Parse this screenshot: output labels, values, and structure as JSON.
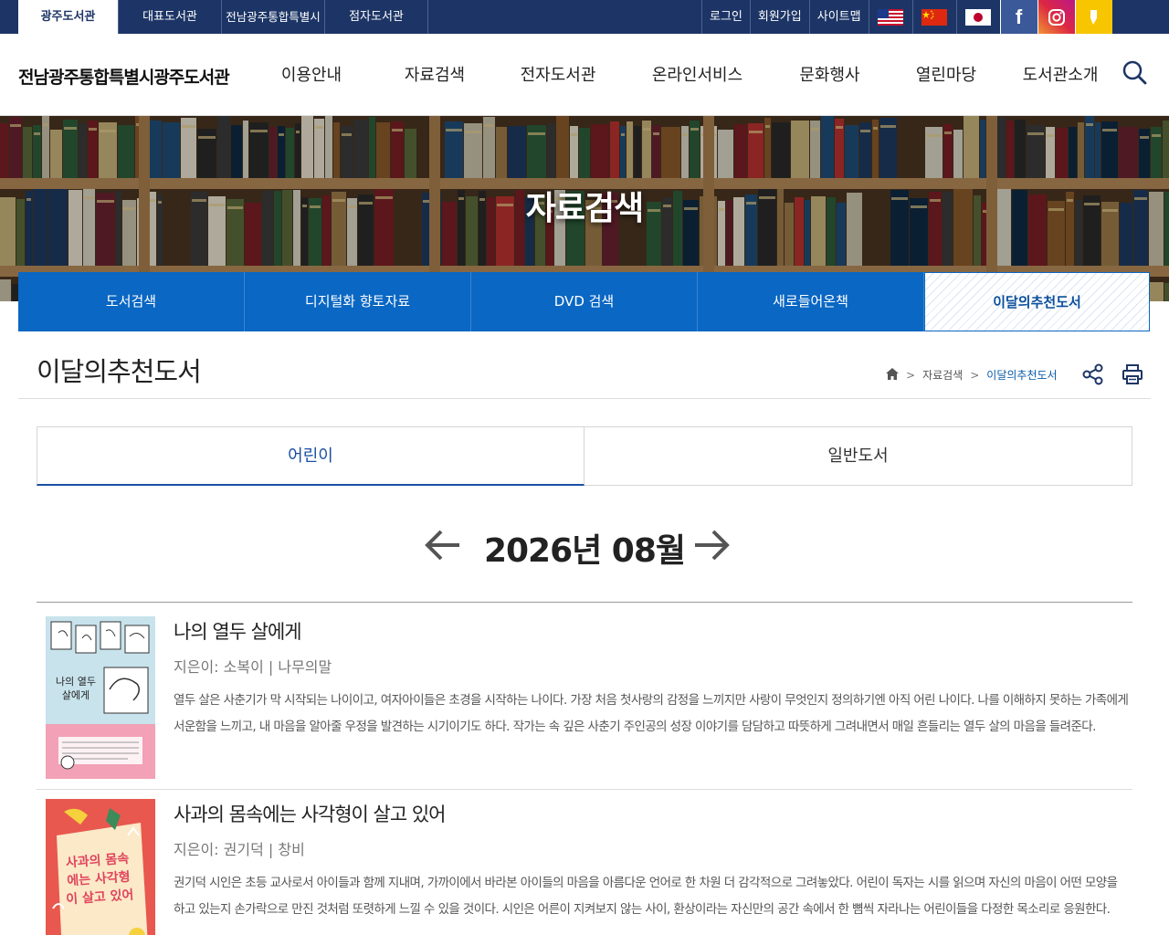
{
  "top_bar": {
    "site_tabs": [
      "광주도서관",
      "대표도서관",
      "전남광주통합특별시",
      "점자도서관"
    ],
    "links": [
      "로그인",
      "회원가입",
      "사이트맵"
    ],
    "languages": [
      "us-flag-icon",
      "china-flag-icon",
      "japan-flag-icon"
    ],
    "social": [
      "facebook-icon",
      "instagram-icon",
      "kakao-icon"
    ]
  },
  "header": {
    "logo": "전남광주통합특별시광주도서관",
    "nav": [
      "이용안내",
      "자료검색",
      "전자도서관",
      "온라인서비스",
      "문화행사",
      "열린마당",
      "도서관소개"
    ]
  },
  "banner": {
    "title": "자료검색"
  },
  "subnav": [
    "도서검색",
    "디지털화 향토자료",
    "DVD 검색",
    "새로들어온책",
    "이달의추천도서"
  ],
  "page": {
    "title": "이달의추천도서",
    "breadcrumb": [
      "자료검색",
      "이달의추천도서"
    ]
  },
  "category_tabs": [
    "어린이",
    "일반도서"
  ],
  "month": "2026년 08월",
  "books": [
    {
      "title": "나의 열두 살에게",
      "meta": "지은이: 소복이 | 나무의말",
      "description": "열두 살은 사춘기가 막 시작되는 나이이고, 여자아이들은 초경을 시작하는 나이다. 가장 처음 첫사랑의 감정을 느끼지만 사랑이 무엇인지 정의하기엔 아직 어린 나이다. 나를 이해하지 못하는 가족에게 서운함을 느끼고, 내 마음을 알아줄 우정을 발견하는 시기이기도 하다. 작가는 속 깊은 사춘기 주인공의 성장 이야기를 담담하고 따뜻하게 그려내면서 매일 흔들리는 열두 살의 마음을 들려준다.",
      "cover_text": "나의 열두 살에게"
    },
    {
      "title": "사과의 몸속에는 사각형이 살고 있어",
      "meta": "지은이: 권기덕 | 창비",
      "description": "권기덕 시인은 초등 교사로서 아이들과 함께 지내며, 가까이에서 바라본 아이들의 마음을 아름다운 언어로 한 차원 더 감각적으로 그려놓았다. 어린이 독자는 시를 읽으며 자신의 마음이 어떤 모양을 하고 있는지 손가락으로 만진 것처럼 또렷하게 느낄 수 있을 것이다. 시인은 어른이 지켜보지 않는 사이, 환상이라는 자신만의 공간 속에서 한 뼘씩 자라나는 어린이들을 다정한 목소리로 응원한다.",
      "cover_text": "사과의 몸속에는 사각형이 살고 있어"
    }
  ],
  "colors": {
    "top_bar": "#1d3566",
    "subnav": "#0a67c3",
    "accent": "#1a4fa3",
    "breadcrumb_current": "#0a5aa8"
  }
}
